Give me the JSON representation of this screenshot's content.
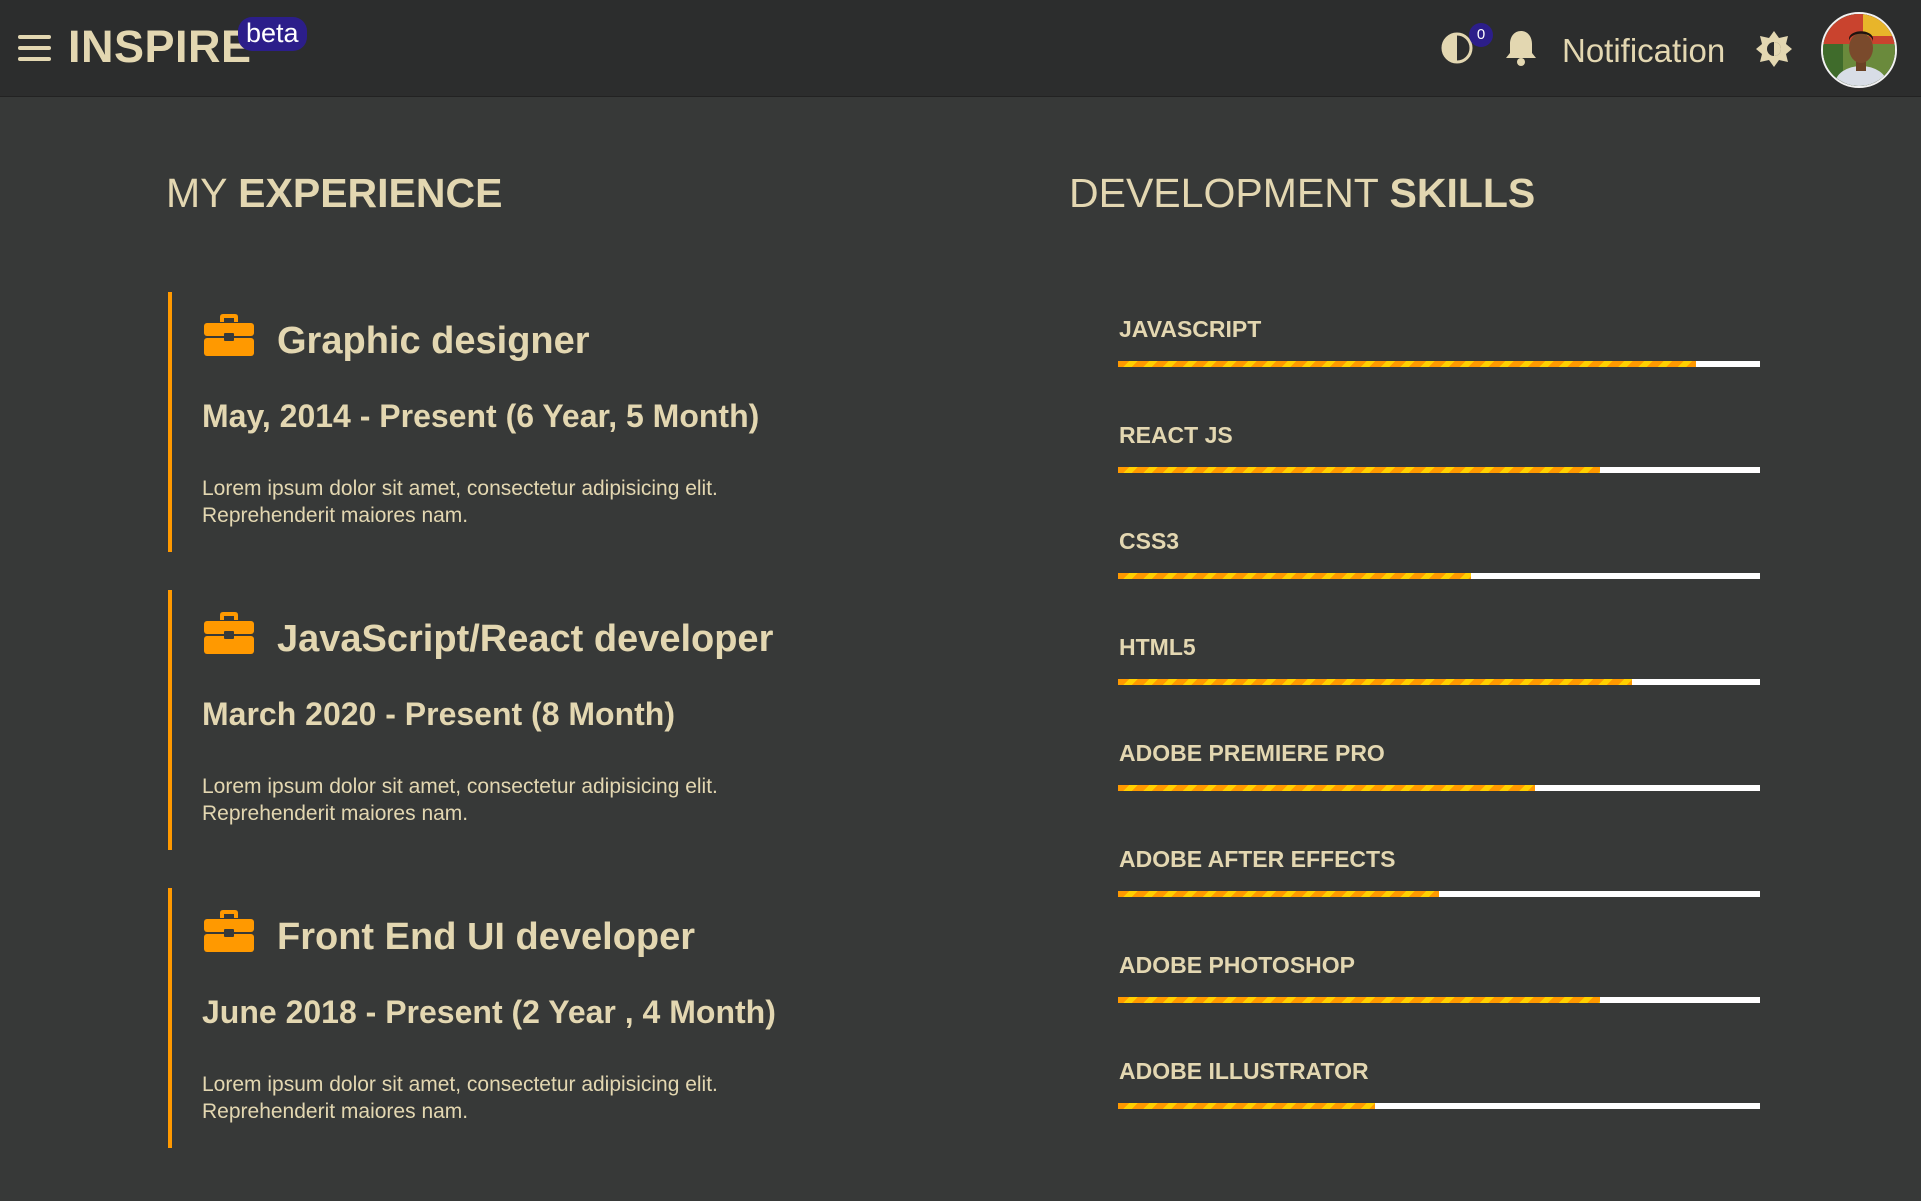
{
  "header": {
    "brand": "INSPIRE",
    "beta_label": "beta",
    "badge_count": "0",
    "notification_label": "Notification",
    "icons": [
      "menu-icon",
      "contrast-icon",
      "bell-icon",
      "sun-icon"
    ]
  },
  "experience": {
    "title_light": "MY ",
    "title_bold": "EXPERIENCE",
    "items": [
      {
        "title": "Graphic designer",
        "period": "May, 2014 - Present (6 Year, 5 Month)",
        "desc_line1": "Lorem ipsum dolor sit amet, consectetur adipisicing elit.",
        "desc_line2": "Reprehenderit maiores nam."
      },
      {
        "title": "JavaScript/React developer",
        "period": "March 2020 - Present (8 Month)",
        "desc_line1": "Lorem ipsum dolor sit amet, consectetur adipisicing elit.",
        "desc_line2": "Reprehenderit maiores nam."
      },
      {
        "title": "Front End UI developer",
        "period": "June 2018 - Present (2 Year , 4 Month)",
        "desc_line1": "Lorem ipsum dolor sit amet, consectetur adipisicing elit.",
        "desc_line2": "Reprehenderit maiores nam."
      }
    ]
  },
  "skills": {
    "title_light": "DEVELOPMENT ",
    "title_bold": "SKILLS",
    "items": [
      {
        "name": "JAVASCRIPT",
        "percent": 90
      },
      {
        "name": "REACT JS",
        "percent": 75
      },
      {
        "name": "CSS3",
        "percent": 55
      },
      {
        "name": "HTML5",
        "percent": 80
      },
      {
        "name": "ADOBE PREMIERE PRO",
        "percent": 65
      },
      {
        "name": "ADOBE AFTER EFFECTS",
        "percent": 50
      },
      {
        "name": "ADOBE PHOTOSHOP",
        "percent": 75
      },
      {
        "name": "ADOBE ILLUSTRATOR",
        "percent": 40
      }
    ]
  },
  "colors": {
    "accent": "#ff9900",
    "stripe": "#ffd000",
    "text": "#e3d7b1",
    "background": "#373938",
    "header": "#2c2d2d",
    "badge": "#2c1e8a"
  }
}
